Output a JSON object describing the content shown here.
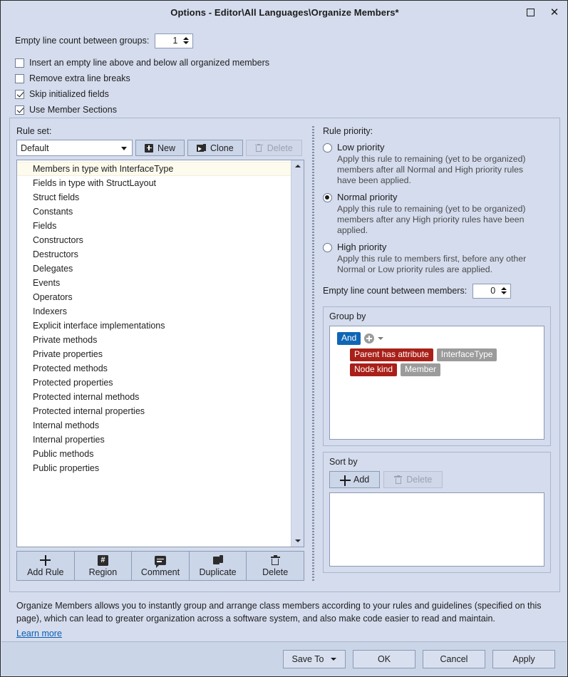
{
  "window": {
    "title": "Options - Editor\\All Languages\\Organize Members*",
    "maximize_label": "Maximize",
    "close_label": "✕"
  },
  "top_options": {
    "empty_line_groups_label": "Empty line count between groups:",
    "empty_line_groups_value": "1",
    "checkboxes": [
      {
        "label": "Insert an empty line above and below all organized members",
        "checked": false
      },
      {
        "label": "Remove extra line breaks",
        "checked": false
      },
      {
        "label": "Skip initialized fields",
        "checked": true
      },
      {
        "label": "Use Member Sections",
        "checked": true
      }
    ]
  },
  "rule_set": {
    "label": "Rule set:",
    "selected": "Default",
    "new_label": "New",
    "clone_label": "Clone",
    "delete_label": "Delete",
    "rules": [
      {
        "label": "Members in type with InterfaceType",
        "selected": true
      },
      {
        "label": "Fields in type with StructLayout",
        "selected": false
      },
      {
        "label": "Struct fields",
        "selected": false
      },
      {
        "label": "Constants",
        "selected": false
      },
      {
        "label": "Fields",
        "selected": false
      },
      {
        "label": "Constructors",
        "selected": false
      },
      {
        "label": "Destructors",
        "selected": false
      },
      {
        "label": "Delegates",
        "selected": false
      },
      {
        "label": "Events",
        "selected": false
      },
      {
        "label": "Operators",
        "selected": false
      },
      {
        "label": "Indexers",
        "selected": false
      },
      {
        "label": "Explicit interface implementations",
        "selected": false
      },
      {
        "label": "Private methods",
        "selected": false
      },
      {
        "label": "Private properties",
        "selected": false
      },
      {
        "label": "Protected methods",
        "selected": false
      },
      {
        "label": "Protected properties",
        "selected": false
      },
      {
        "label": "Protected internal methods",
        "selected": false
      },
      {
        "label": "Protected internal properties",
        "selected": false
      },
      {
        "label": "Internal methods",
        "selected": false
      },
      {
        "label": "Internal properties",
        "selected": false
      },
      {
        "label": "Public methods",
        "selected": false
      },
      {
        "label": "Public properties",
        "selected": false
      }
    ],
    "toolbar": [
      {
        "label": "Add Rule",
        "icon": "plus-icon"
      },
      {
        "label": "Region",
        "icon": "region-hash-icon"
      },
      {
        "label": "Comment",
        "icon": "comment-bubble-icon"
      },
      {
        "label": "Duplicate",
        "icon": "duplicate-icon"
      },
      {
        "label": "Delete",
        "icon": "trash-icon"
      }
    ]
  },
  "rule_priority": {
    "label": "Rule priority:",
    "options": [
      {
        "label": "Low priority",
        "selected": false,
        "description": "Apply this rule to remaining (yet to be organized) members after all Normal and High priority rules have been applied."
      },
      {
        "label": "Normal priority",
        "selected": true,
        "description": "Apply this rule to remaining (yet to be organized) members after any High priority rules have been applied."
      },
      {
        "label": "High priority",
        "selected": false,
        "description": "Apply this rule to members first, before any other Normal or Low priority rules are applied."
      }
    ],
    "empty_line_members_label": "Empty line count between members:",
    "empty_line_members_value": "0"
  },
  "group_by": {
    "title": "Group by",
    "operator_chip": "And",
    "conditions": [
      {
        "key": "Parent has attribute",
        "value": "InterfaceType"
      },
      {
        "key": "Node kind",
        "value": "Member"
      }
    ]
  },
  "sort_by": {
    "title": "Sort by",
    "add_label": "Add",
    "delete_label": "Delete",
    "items": []
  },
  "footer": {
    "description": "Organize Members allows you to instantly group and arrange class members according to your rules and guidelines (specified on this page), which can lead to greater organization across a software system, and also make code easier to read and maintain.",
    "learn_more": "Learn more",
    "buttons": {
      "save_to": "Save To",
      "ok": "OK",
      "cancel": "Cancel",
      "apply": "Apply"
    }
  },
  "colors": {
    "dialog_bg": "#d4dced",
    "operator_chip": "#0f66b5",
    "key_chip": "#a92019",
    "value_chip": "#9b9b9b",
    "link": "#0a5fb4",
    "selected_row": "#fdfbee"
  }
}
